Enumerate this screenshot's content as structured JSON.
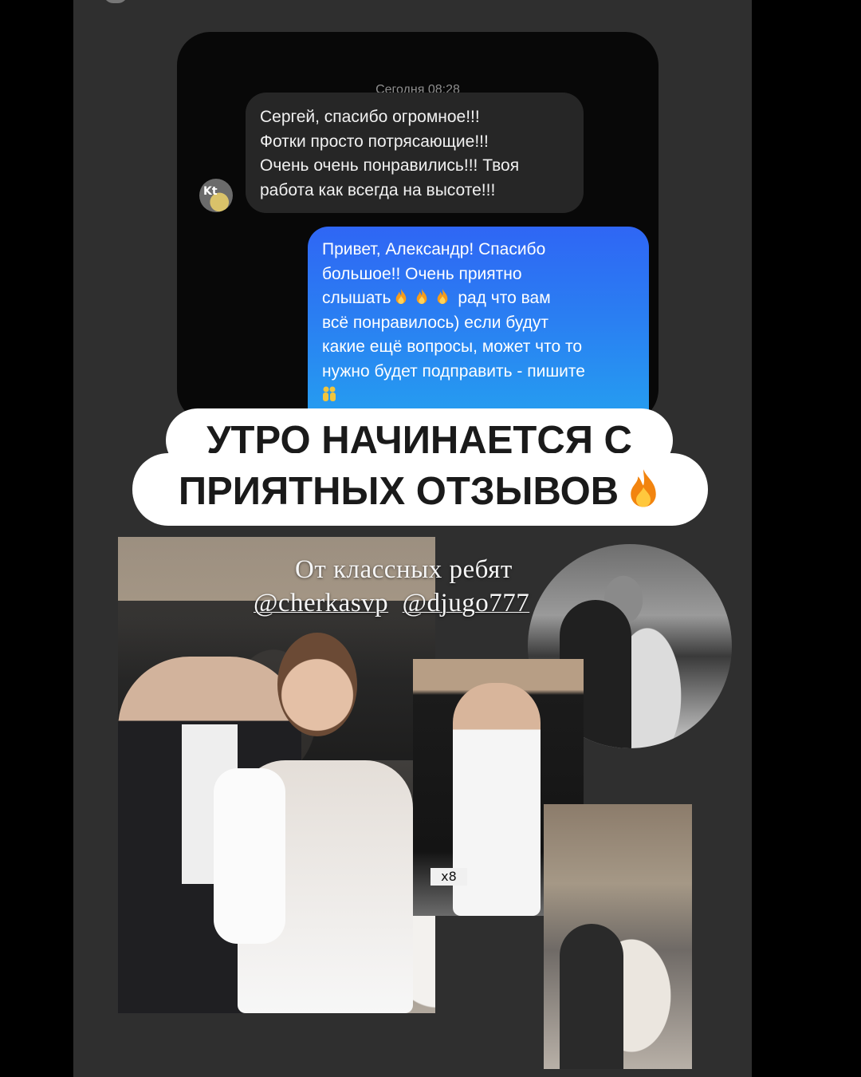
{
  "chat": {
    "timestamp": "Сегодня 08:28",
    "incoming": {
      "avatar_initials": "Kt",
      "text": "Сергей, спасибо огромное!!!\nФотки просто потрясающие!!!\nОчень очень понравились!!! Твоя\nработа как всегда на высоте!!!"
    },
    "outgoing": {
      "lines": [
        "Привет, Александр! Спасибо",
        "большое!! Очень приятно",
        "слышать",
        "рад что вам",
        "всё понравилось) если  будут",
        "какие ещё вопросы, может что то",
        "нужно будет подправить - пишите"
      ]
    }
  },
  "banner": {
    "line1": "УТРО НАЧИНАЕТСЯ С",
    "line2": "ПРИЯТНЫХ ОТЗЫВОВ"
  },
  "caption": {
    "line1": "От классных ребят",
    "handle1": "@cherkasvp",
    "handle2": "@djugo777"
  },
  "photos": {
    "mid_plate": "x8"
  },
  "colors": {
    "story_bg": "#2f2f2f",
    "chat_bg": "#080808",
    "incoming_bubble": "#262626",
    "outgoing_gradient_top": "#2f66f4",
    "outgoing_gradient_bottom": "#24a3f0",
    "banner_bg": "#ffffff"
  },
  "icons": [
    "fire-emoji-icon",
    "people-emoji-icon",
    "avatar-image"
  ]
}
